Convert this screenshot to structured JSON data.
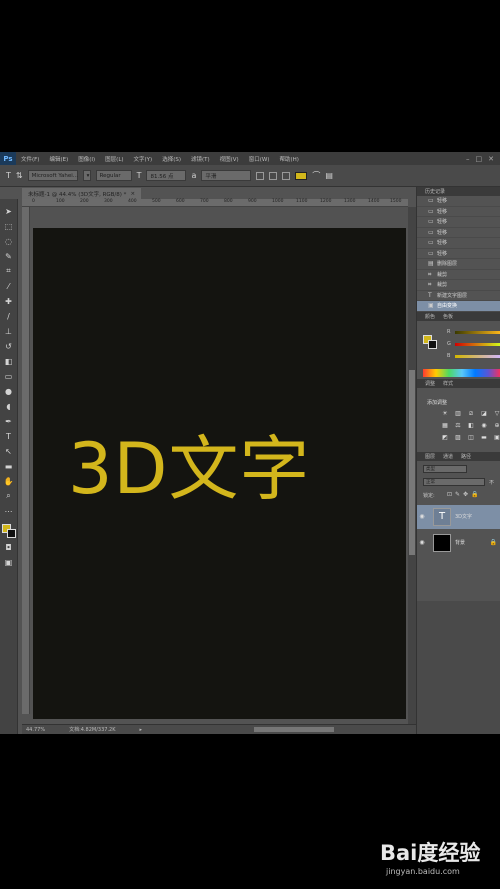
{
  "app": {
    "logo": "Ps"
  },
  "menu": [
    "文件(F)",
    "编辑(E)",
    "图像(I)",
    "图层(L)",
    "文字(Y)",
    "选择(S)",
    "滤镜(T)",
    "视图(V)",
    "窗口(W)",
    "帮助(H)"
  ],
  "options": {
    "tool_icon": "T",
    "font_family": "Microsoft Yahei...",
    "font_style": "Regular",
    "font_size": "81.56 点",
    "antialias_label": "a",
    "antialias_value": "平滑",
    "text_color": "#d2b71b"
  },
  "document": {
    "tab_title": "未标题-1 @ 44.4% (3D文字, RGB/8) *",
    "canvas_text": "3D文字",
    "ruler_ticks": [
      "0",
      "100",
      "200",
      "300",
      "400",
      "500",
      "600",
      "700",
      "800",
      "900",
      "1000",
      "1100",
      "1200",
      "1300",
      "1400",
      "1500"
    ]
  },
  "status": {
    "zoom": "44.77%",
    "doc_info": "文档:4.82M/337.2K"
  },
  "colors": {
    "accent": "#d2b71b",
    "canvas": "#141410"
  },
  "history": {
    "tabs": [
      "历史记录"
    ],
    "items": [
      {
        "label": "轻移",
        "icon": "move-icon"
      },
      {
        "label": "轻移",
        "icon": "move-icon"
      },
      {
        "label": "轻移",
        "icon": "move-icon"
      },
      {
        "label": "轻移",
        "icon": "move-icon"
      },
      {
        "label": "轻移",
        "icon": "move-icon"
      },
      {
        "label": "轻移",
        "icon": "move-icon"
      },
      {
        "label": "删除图层",
        "icon": "layer-icon"
      },
      {
        "label": "裁剪",
        "icon": "crop-icon"
      },
      {
        "label": "裁剪",
        "icon": "crop-icon"
      },
      {
        "label": "新建文字图层",
        "icon": "type-icon"
      },
      {
        "label": "自由变换",
        "icon": "transform-icon"
      }
    ]
  },
  "color_panel": {
    "tabs": [
      "颜色",
      "色板"
    ],
    "labels": [
      "R",
      "G",
      "B"
    ]
  },
  "adjustments": {
    "tabs": [
      "调整",
      "样式"
    ],
    "label": "添加调整"
  },
  "layers": {
    "tabs": [
      "图层",
      "通道",
      "路径"
    ],
    "kind": "类型",
    "blend_mode": "正常",
    "opacity_label": "不",
    "lock_label": "锁定:",
    "items": [
      {
        "name": "3D文字",
        "thumb": "T",
        "selected": true
      },
      {
        "name": "背景",
        "thumb": "",
        "selected": false
      }
    ]
  },
  "watermark": {
    "logo": "Bai度经验",
    "url": "jingyan.baidu.com"
  }
}
